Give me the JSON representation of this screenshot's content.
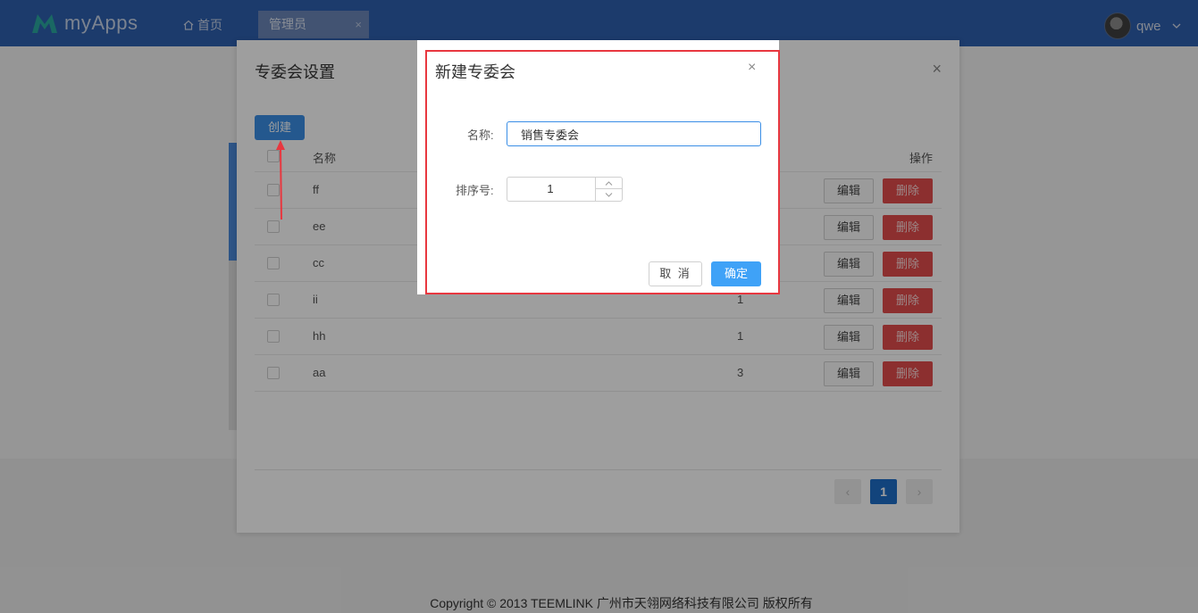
{
  "topbar": {
    "logo_text": "myApps",
    "nav_home": "首页",
    "tab_active": "管理员",
    "tab_close": "×",
    "user_name": "qwe"
  },
  "panel": {
    "title": "专委会设置",
    "close": "×",
    "create_label": "创建",
    "columns": {
      "name": "名称",
      "sort": "",
      "operation": "操作"
    },
    "rows": [
      {
        "name": "ff",
        "sort": ""
      },
      {
        "name": "ee",
        "sort": ""
      },
      {
        "name": "cc",
        "sort": ""
      },
      {
        "name": "ii",
        "sort": "1"
      },
      {
        "name": "hh",
        "sort": "1"
      },
      {
        "name": "aa",
        "sort": "3"
      }
    ],
    "edit_label": "编辑",
    "delete_label": "删除",
    "pager": {
      "prev": "‹",
      "current": "1",
      "next": "›"
    }
  },
  "dialog": {
    "title": "新建专委会",
    "close": "×",
    "name_label": "名称:",
    "name_value": "销售专委会",
    "sort_label": "排序号:",
    "sort_value": "1",
    "cancel_label": "取 消",
    "ok_label": "确定"
  },
  "footer": {
    "copyright": "Copyright © 2013 TEEMLINK 广州市天翎网络科技有限公司 版权所有"
  },
  "colors": {
    "topbar": "#2e5fae",
    "primary": "#3a8ee6",
    "danger": "#e34d4d",
    "annotation": "#e8373f"
  }
}
